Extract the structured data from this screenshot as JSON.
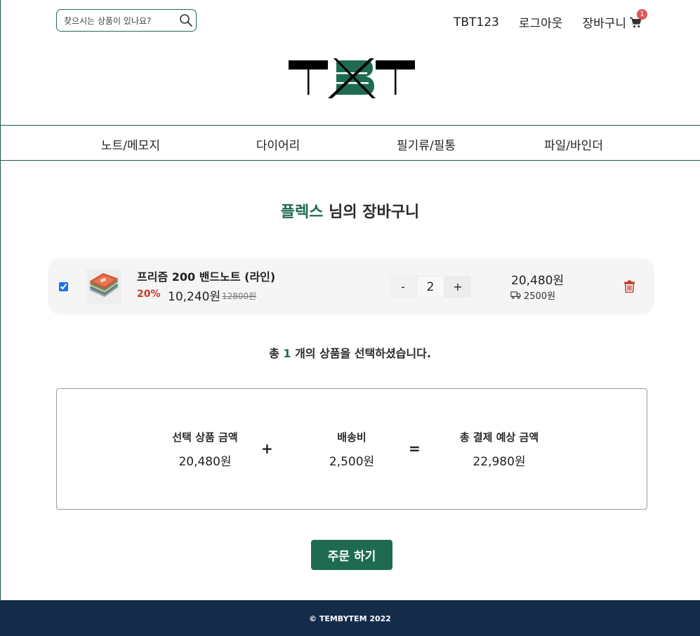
{
  "header": {
    "search_placeholder": "찾으시는 상품이 있나요?",
    "username": "TBT123",
    "logout_label": "로그아웃",
    "cart_label": "장바구니",
    "cart_badge": "1",
    "logo_text": "TBT"
  },
  "categories": [
    "노트/메모지",
    "다이어리",
    "필기류/필통",
    "파일/바인더"
  ],
  "page": {
    "title_user": "플렉스",
    "title_suffix": " 님의 장바구니"
  },
  "cart_item": {
    "checked": true,
    "name": "프리즘 200 밴드노트 (라인)",
    "discount": "20%",
    "price": "10,240원",
    "original_price": "12800원",
    "quantity": "2",
    "minus_label": "-",
    "plus_label": "+",
    "total": "20,480원",
    "shipping": "2500원"
  },
  "selection": {
    "prefix": "총 ",
    "count": "1",
    "suffix": " 개의 상품을 선택하셨습니다."
  },
  "totals": {
    "subtotal_label": "선택 상품 금액",
    "subtotal_value": "20,480원",
    "plus": "+",
    "shipping_label": "배송비",
    "shipping_value": "2,500원",
    "equals": "=",
    "grand_label": "총 결제 예상 금액",
    "grand_value": "22,980원"
  },
  "order_button_label": "주문 하기",
  "footer_text": "© TEMBYTEM 2022",
  "colors": {
    "brand_green": "#1f6b52",
    "footer_navy": "#142b4a",
    "discount_red": "#c0392b",
    "badge_red": "#e05555"
  }
}
